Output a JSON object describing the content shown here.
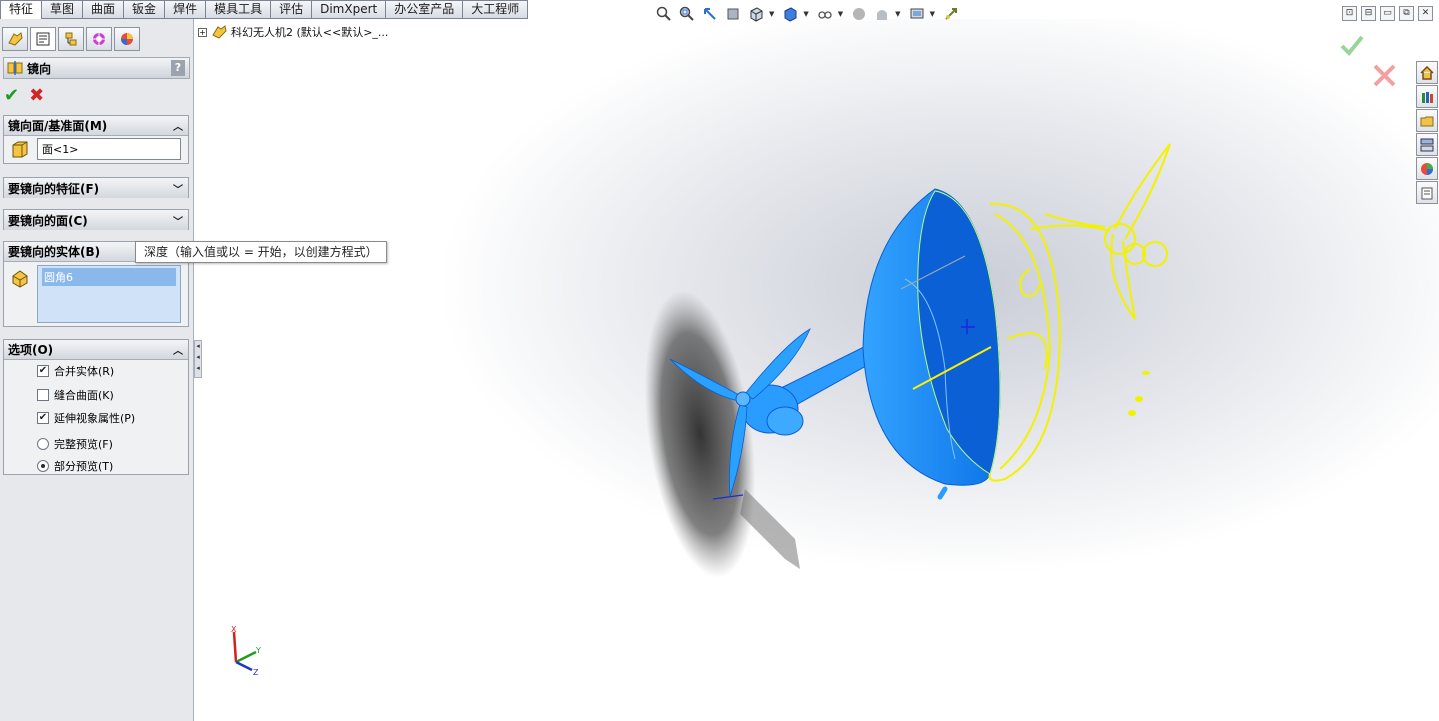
{
  "tabs": [
    "特征",
    "草图",
    "曲面",
    "钣金",
    "焊件",
    "模具工具",
    "评估",
    "DimXpert",
    "办公室产品",
    "大工程师"
  ],
  "active_tab": "特征",
  "panel_tabs": [
    "feature-manager-icon",
    "property-manager-icon",
    "configuration-manager-icon",
    "dimxpert-manager-icon",
    "display-manager-icon"
  ],
  "property_manager": {
    "title": "镜向",
    "help": "?",
    "ok_glyph": "✔",
    "cancel_glyph": "✖",
    "mirror_plane": {
      "header": "镜向面/基准面(M)",
      "value": "面<1>"
    },
    "features_to_mirror": {
      "header": "要镜向的特征(F)"
    },
    "faces_to_mirror": {
      "header": "要镜向的面(C)"
    },
    "bodies_to_mirror": {
      "header": "要镜向的实体(B)",
      "items": [
        "圆角6"
      ]
    },
    "options": {
      "header": "选项(O)",
      "merge_solids": {
        "label": "合并实体(R)",
        "checked": true
      },
      "knit_surfaces": {
        "label": "缝合曲面(K)",
        "checked": false
      },
      "propagate_visual": {
        "label": "延伸视象属性(P)",
        "checked": true
      },
      "full_preview": {
        "label": "完整预览(F)",
        "selected": false
      },
      "partial_preview": {
        "label": "部分预览(T)",
        "selected": true
      }
    },
    "chevron_up": "⌃",
    "chevron_down": "⌄"
  },
  "tooltip": "深度（输入值或以 = 开始，以创建方程式）",
  "tree": {
    "expander": "+",
    "label": "科幻无人机2  (默认<<默认>_..."
  },
  "hud_icons": [
    "zoom-to-fit-icon",
    "zoom-to-area-icon",
    "previous-view-icon",
    "section-view-icon",
    "view-orientation-icon",
    "display-style-icon",
    "hide-show-items-icon",
    "edit-appearance-icon",
    "apply-scene-icon",
    "view-settings-icon",
    "rotate-icon"
  ],
  "window_buttons": [
    "⊡",
    "⊟",
    "▭",
    "⧉",
    "✕"
  ],
  "taskpane_icons": [
    "home-icon",
    "design-library-icon",
    "file-explorer-icon",
    "view-palette-icon",
    "appearances-icon",
    "custom-properties-icon"
  ],
  "triad": {
    "x": "X",
    "y": "Y",
    "z": "Z"
  },
  "colors": {
    "model_blue": "#1e90ff",
    "model_dark": "#0b5fd4",
    "preview_yellow": "#f2f200",
    "ok_green": "#1f9c1f",
    "cancel_red": "#d42424"
  }
}
